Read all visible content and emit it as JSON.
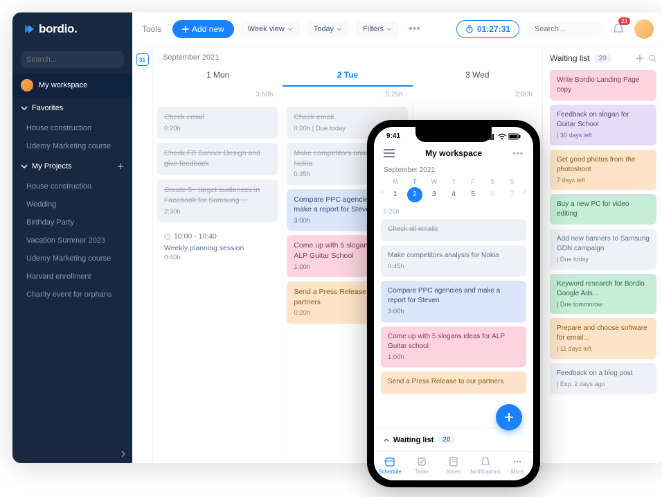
{
  "brand": "bordio.",
  "sidebar": {
    "search_placeholder": "Search...",
    "workspace": "My workspace",
    "favorites_label": "Favorites",
    "favorites": [
      "House construction",
      "Udemy Marketing course"
    ],
    "projects_label": "My Projects",
    "projects": [
      "House construction",
      "Wedding",
      "Birthday Party",
      "Vacation Summer 2023",
      "Udemy Marketing course",
      "Harvard enrollment",
      "Charity event for orphans"
    ]
  },
  "toolbar": {
    "tools": "Tools",
    "add": "Add new",
    "view": "Week view",
    "today": "Today",
    "filters": "Filters",
    "timer": "01:27:31",
    "search_placeholder": "Search...",
    "notif_count": "23"
  },
  "week": {
    "month": "September 2021",
    "cal_icon": "31",
    "days": [
      {
        "label": "1 Mon",
        "hours": "3:50h"
      },
      {
        "label": "2 Tue",
        "hours": "5:25h"
      },
      {
        "label": "3 Wed",
        "hours": "2:00h"
      }
    ],
    "columns": [
      [
        {
          "title": "Check email",
          "meta": "0:20h",
          "color": "gray",
          "done": true
        },
        {
          "title": "Check FB Banner Design and give feedback",
          "meta": "",
          "color": "gray",
          "done": true
        },
        {
          "title": "Create 5+ target audiences in Facebook for Samsung ...",
          "meta": "2:30h",
          "color": "gray",
          "done": true
        },
        {
          "title": "Weekly planning session",
          "meta": "0:40h",
          "time": "10:00 - 10:40",
          "color": "grayline"
        }
      ],
      [
        {
          "title": "Check email",
          "meta": "0:20h | Due today",
          "color": "gray",
          "done": true
        },
        {
          "title": "Make competitors analysis for Nokia",
          "meta": "0:45h",
          "color": "gray",
          "done": true
        },
        {
          "title": "Compare PPC agencies and make a report for Steven",
          "meta": "3:00h",
          "color": "blue"
        },
        {
          "title": "Come up with 5 slogan ideas for ALP Guitar School",
          "meta": "1:00h",
          "color": "pink"
        },
        {
          "title": "Send a Press Release to our partners",
          "meta": "0:20h",
          "color": "orange"
        }
      ],
      []
    ]
  },
  "waiting": {
    "title": "Waiting list",
    "count": "20",
    "items": [
      {
        "title": "Write Bordio Landing Page copy",
        "sub": "",
        "color": "pink"
      },
      {
        "title": "Feedback on slogan for Guitar School",
        "sub": "| 30 days left",
        "color": "purple"
      },
      {
        "title": "Get good photos from the photoshoot",
        "sub": "7 days left",
        "color": "orange"
      },
      {
        "title": "Buy a new PC for video editing",
        "sub": "",
        "color": "green"
      },
      {
        "title": "Add new banners to Samsung GDN campaign",
        "sub": "| Due today",
        "color": "gray"
      },
      {
        "title": "Keyword research for Bordio Google Ads...",
        "sub": "| Due tommorow",
        "color": "green"
      },
      {
        "title": "Prepare and choose software for email...",
        "sub": "| 11 days left",
        "color": "orange"
      },
      {
        "title": "Feedback on a blog post",
        "sub": "| Exp. 2 days ago",
        "color": "gray"
      }
    ]
  },
  "phone": {
    "time": "9:41",
    "title": "My workspace",
    "month": "September 2021",
    "day_labels": [
      "M",
      "T",
      "W",
      "T",
      "F",
      "S",
      "S"
    ],
    "day_nums": [
      "1",
      "2",
      "3",
      "4",
      "5",
      "6",
      "7"
    ],
    "active_index": 1,
    "hours": "5:25h",
    "tasks": [
      {
        "title": "Check all emails",
        "meta": "",
        "color": "gray",
        "done": true
      },
      {
        "title": "Make competitors analysis for Nokia",
        "meta": "0:45h",
        "color": "gray"
      },
      {
        "title": "Compare PPC agencies and make a report for Steven",
        "meta": "3:00h",
        "color": "blue"
      },
      {
        "title": "Come up with 5 slogans ideas for ALP Guitar school",
        "meta": "1:00h",
        "color": "pink"
      },
      {
        "title": "Send a Press Release to our partners",
        "meta": "",
        "color": "orange"
      }
    ],
    "waiting_label": "Waiting list",
    "waiting_count": "20",
    "tabs": [
      "Schedule",
      "Tasks",
      "Notes",
      "Notifications",
      "More"
    ]
  }
}
